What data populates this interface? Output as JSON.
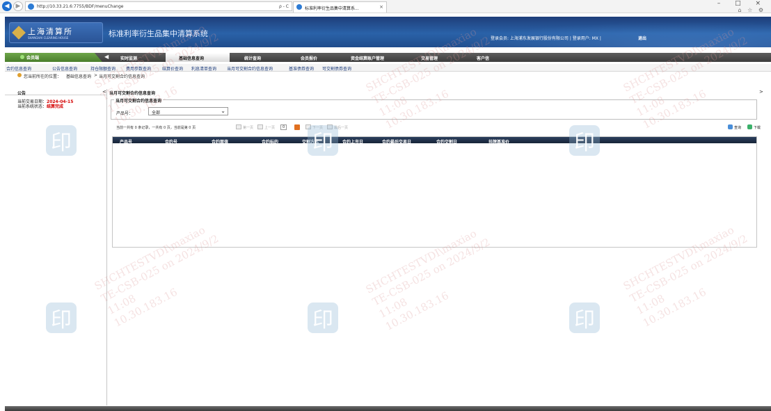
{
  "browser": {
    "url": "http://10.33.21.6:7755/BDF/menuChange",
    "url_controls": "ρ - C",
    "tab_title": "标准利率衍生品集中清算系...",
    "window_controls": "– □ ×",
    "toolbar_icons": "⌂ ☆ ⚙"
  },
  "header": {
    "logo_cn": "上海清算所",
    "logo_en": "SHANGHAI CLEARING HOUSE",
    "system_title": "标准利率衍生品集中清算系统",
    "login_info": "登录会员: 上海浦东发展银行股份有限公司  |  登录用户: MX  |",
    "logout": "退出"
  },
  "menu": {
    "member_label": "会员端",
    "items": [
      "实时监测",
      "基础信息查询",
      "统计查询",
      "会员报价",
      "资金结算账户管理",
      "交易管理",
      "客户信"
    ],
    "active_index": 1
  },
  "submenu": {
    "items": [
      "合约信息查询",
      "公告信息查询",
      "持仓限额查询",
      "费用参数查询",
      "结算价查询",
      "利息清单查询",
      "当月可交割合约信息查询",
      "基准债券查询",
      "可交割债券查询"
    ]
  },
  "breadcrumb": {
    "prefix": "您当前所在的位置：",
    "path": [
      "基础信息查询",
      "当月可交割合约信息查询"
    ],
    "separator": ">"
  },
  "left_panel": {
    "title": "公告",
    "toggle": "<",
    "trade_date_label": "当前交易日期：",
    "trade_date": "2024-04-15",
    "status_label": "当前系统状态：",
    "status": "结算完成"
  },
  "right_panel": {
    "title": "当月可交割合约信息查询",
    "toggle": ">",
    "fieldset_legend": "当月可交割合约信息查询",
    "product_label": "产品号：",
    "product_value": "全部",
    "pager": {
      "summary": "当前一共有 0 条记录，一共有 0 页，当前是第 0 页",
      "first": "第一页",
      "prev": "上一页",
      "page_input": "0",
      "next": "下一页",
      "last": "最后一页"
    },
    "search_label": "查询",
    "download_label": "下载",
    "columns": [
      "产品号",
      "合约号",
      "合约面值",
      "合约标的",
      "交割方式",
      "合约上市日",
      "合约最后交易日",
      "合约交割日",
      "挂牌基准价"
    ]
  },
  "watermark": {
    "line1": "SHCHTESTVDI\\maxiao",
    "line2": "TE-CSB-025 on 2024/9/2",
    "line3": "11:08",
    "line4": "10.30.183.16",
    "stamp": "印"
  },
  "colors": {
    "header_blue": "#2a62a8",
    "member_green": "#5a9236",
    "alert_red": "#d40000",
    "grid_header": "#1f2e48"
  }
}
